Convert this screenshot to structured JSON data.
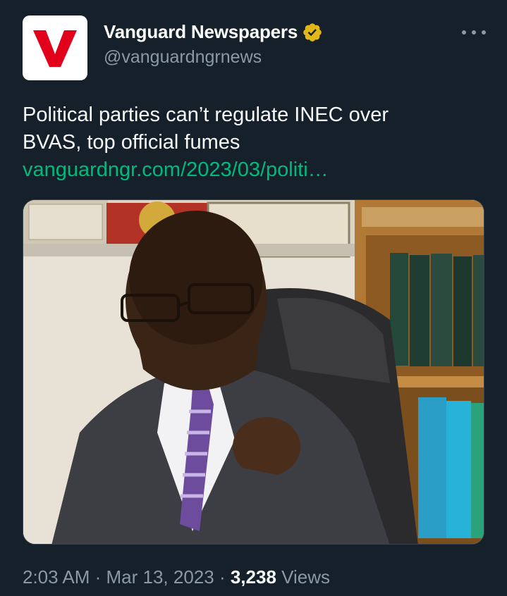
{
  "author": {
    "display_name": "Vanguard Newspapers",
    "handle": "@vanguardngrnews",
    "avatar_letter": "V",
    "verified": true,
    "avatar_color": "#e3001b",
    "verified_color": "#e2b719"
  },
  "tweet": {
    "text_line1": "Political parties can’t regulate INEC over",
    "text_line2": "BVAS, top official fumes",
    "link_text": "vanguardngr.com/2023/03/politi…",
    "link_color": "#00ba7c"
  },
  "media": {
    "icon": "photo-of-official-in-office"
  },
  "meta": {
    "time": "2:03 AM",
    "separator1": " · ",
    "date": "Mar 13, 2023",
    "separator2": " · ",
    "views_count": "3,238",
    "views_label": " Views"
  },
  "icons": {
    "more": "more-horizontal-icon",
    "verified": "verified-badge-icon"
  },
  "theme": {
    "background": "#15202b",
    "secondary_text": "#8b98a5"
  }
}
